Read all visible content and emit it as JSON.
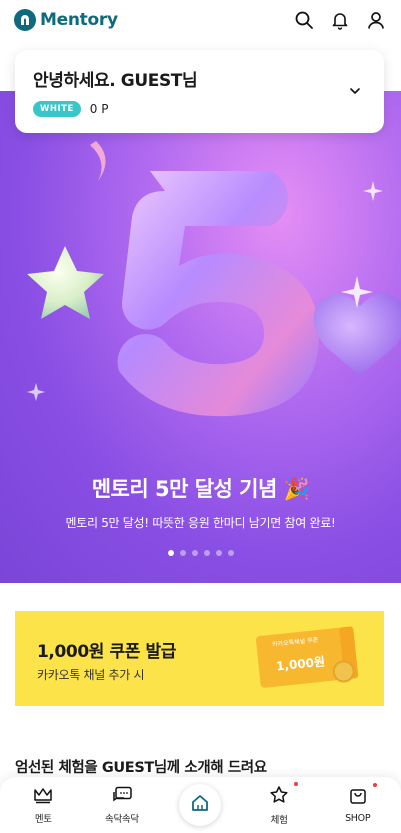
{
  "header": {
    "brand": "Mentory",
    "icons": [
      "search-icon",
      "bell-icon",
      "user-icon"
    ]
  },
  "welcome": {
    "greeting": "안녕하세요. GUEST님",
    "grade": "WHITE",
    "points": "0 P"
  },
  "banner": {
    "title": "멘토리 5만 달성 기념 🎉",
    "subtitle": "멘토리 5만 달성! 따뜻한 응원 한마디 남기면 참여 완료!",
    "slide_count": 6,
    "active_slide": 1,
    "colors": {
      "bg_light": "#e58ef5",
      "bg_dark": "#7a45d8"
    }
  },
  "coupon": {
    "title": "1,000원 쿠폰 발급",
    "subtitle": "카카오톡 채널 추가 시",
    "card_header": "카카오톡채널 쿠폰",
    "card_amount": "1,000원",
    "bg_color": "#fde34a"
  },
  "section": {
    "title": "엄선된 체험을 GUEST님께 소개해 드려요"
  },
  "bottom_nav": {
    "items": [
      {
        "label": "멘토",
        "icon": "crown-icon"
      },
      {
        "label": "속닥속닥",
        "icon": "chat-icon"
      },
      {
        "label": "",
        "icon": "home-icon"
      },
      {
        "label": "체험",
        "icon": "star-icon"
      },
      {
        "label": "SHOP",
        "icon": "shopping-bag-icon"
      }
    ]
  },
  "colors": {
    "brand": "#0f6a7d",
    "badge": "#39c6c9",
    "notify_dot": "#ee3b3b"
  }
}
